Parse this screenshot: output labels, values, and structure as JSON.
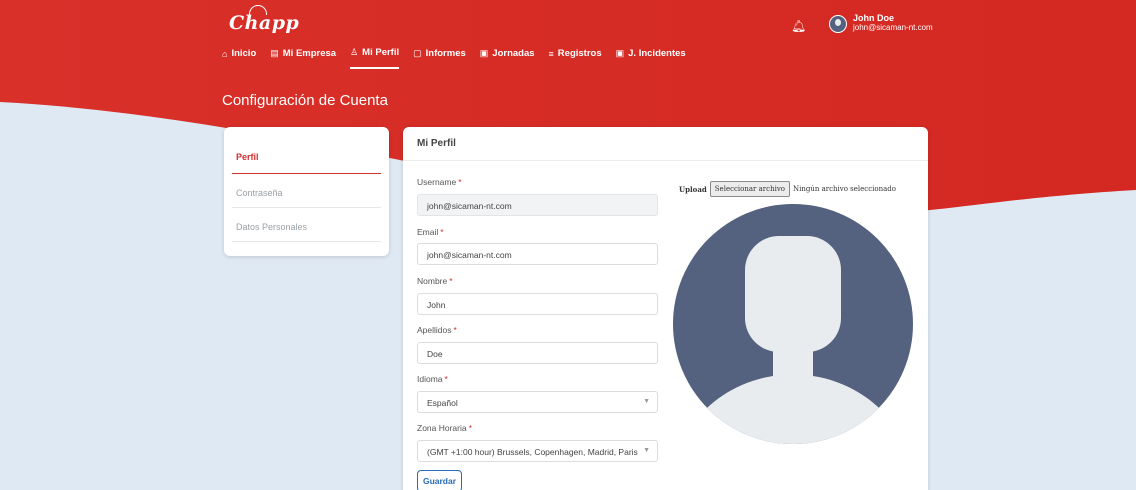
{
  "app": {
    "logo_text": "Chapp"
  },
  "user": {
    "name": "John Doe",
    "email": "john@sicaman-nt.com"
  },
  "nav": [
    {
      "icon": "home-icon",
      "glyph": "⌂",
      "label": "Inicio"
    },
    {
      "icon": "building-icon",
      "glyph": "▤",
      "label": "Mi Empresa"
    },
    {
      "icon": "person-icon",
      "glyph": "♙",
      "label": "Mi Perfil",
      "active": true
    },
    {
      "icon": "document-icon",
      "glyph": "▢",
      "label": "Informes"
    },
    {
      "icon": "calendar-icon",
      "glyph": "▣",
      "label": "Jornadas"
    },
    {
      "icon": "list-icon",
      "glyph": "≡",
      "label": "Registros"
    },
    {
      "icon": "calendar-alert-icon",
      "glyph": "▣",
      "label": "J. Incidentes"
    }
  ],
  "page_title": "Configuración de Cuenta",
  "sidebar": {
    "items": [
      {
        "label": "Perfil",
        "active": true
      },
      {
        "label": "Contraseña"
      },
      {
        "label": "Datos Personales"
      }
    ]
  },
  "profile": {
    "heading": "Mi Perfil",
    "fields": {
      "username": {
        "label": "Username",
        "required_mark": "*",
        "value": "john@sicaman-nt.com"
      },
      "email": {
        "label": "Email",
        "required_mark": "*",
        "value": "john@sicaman-nt.com"
      },
      "nombre": {
        "label": "Nombre",
        "required_mark": "*",
        "value": "John"
      },
      "apellidos": {
        "label": "Apellidos",
        "required_mark": "*",
        "value": "Doe"
      },
      "idioma": {
        "label": "Idioma",
        "required_mark": "*",
        "value": "Español"
      },
      "zona": {
        "label": "Zona Horaria",
        "required_mark": "*",
        "value": "(GMT +1:00 hour) Brussels, Copenhagen, Madrid, Paris"
      }
    },
    "save_label": "Guardar",
    "upload": {
      "label": "Upload",
      "button": "Seleccionar archivo",
      "status": "Ningún archivo seleccionado"
    }
  },
  "colors": {
    "brand_red": "#d92b24",
    "background": "#dfe9f3",
    "avatar_bg": "#54617f",
    "link_blue": "#2a6bb8"
  }
}
